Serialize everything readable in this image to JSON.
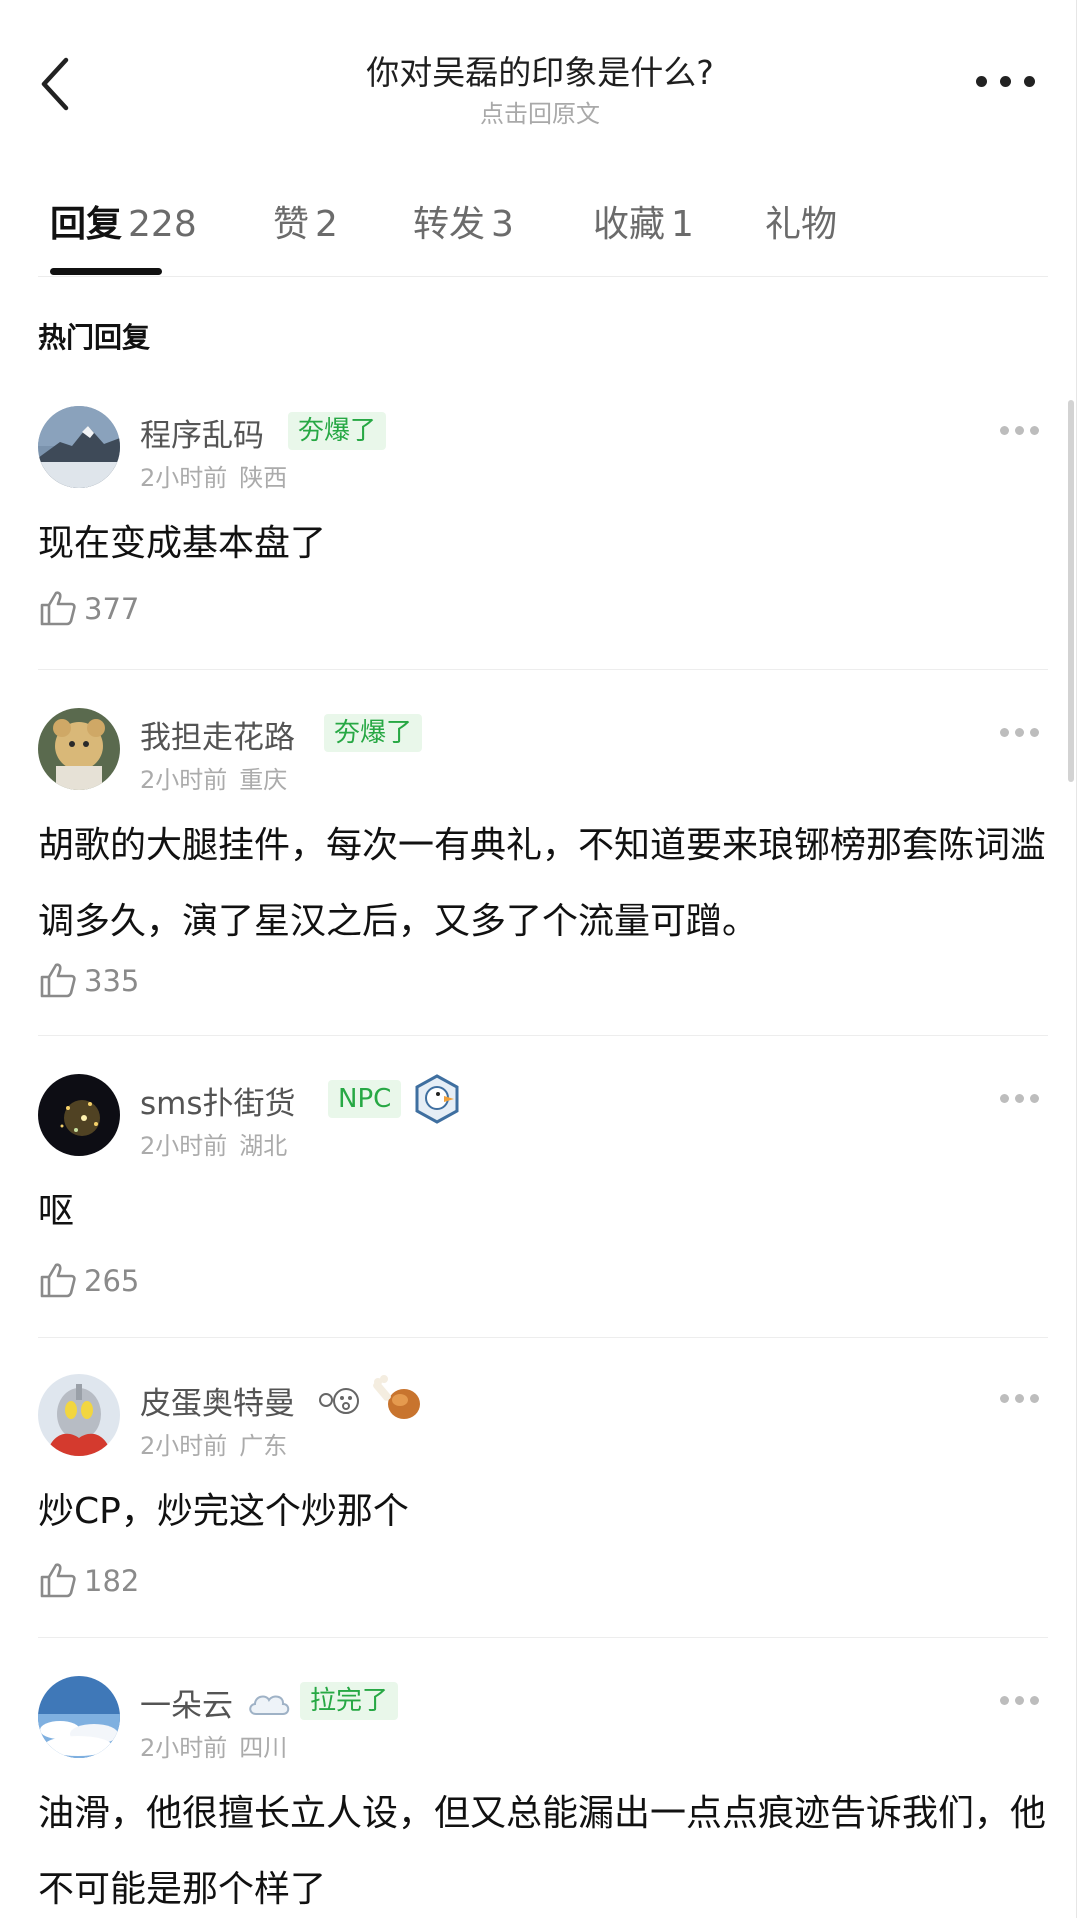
{
  "header": {
    "title": "你对吴磊的印象是什么?",
    "subtitle": "点击回原文",
    "back_icon": "chevron-left-icon",
    "more_icon": "more-horizontal-icon"
  },
  "tabs": [
    {
      "label": "回复",
      "count": "228",
      "active": true
    },
    {
      "label": "赞",
      "count": "2"
    },
    {
      "label": "转发",
      "count": "3"
    },
    {
      "label": "收藏",
      "count": "1"
    },
    {
      "label": "礼物",
      "count": ""
    }
  ],
  "section_title": "热门回复",
  "comments": [
    {
      "username": "程序乱码",
      "badge": "夯爆了",
      "time": "2小时前",
      "location": "陕西",
      "text": "现在变成基本盘了",
      "likes": "377",
      "avatar": "mountain-photo"
    },
    {
      "username": "我担走花路",
      "badge": "夯爆了",
      "time": "2小时前",
      "location": "重庆",
      "text": "胡歌的大腿挂件，每次一有典礼，不知道要来琅铘榜那套陈词滥调多久，演了星汉之后，又多了个流量可蹭。",
      "likes": "335",
      "avatar": "plush-bear-photo"
    },
    {
      "username": "sms扑街货",
      "badge": "NPC",
      "time": "2小时前",
      "location": "湖北",
      "text": "呕",
      "likes": "265",
      "avatar": "dark-sparkle-photo",
      "extra_icon": "duck-hexagon-icon"
    },
    {
      "username": "皮蛋奥特曼",
      "badge": "",
      "time": "2小时前",
      "location": "广东",
      "text": "炒CP，炒完这个炒那个",
      "likes": "182",
      "avatar": "ultraman-photo",
      "extra_icon": "drumstick-icon"
    },
    {
      "username": "一朵云",
      "badge": "拉完了",
      "time": "2小时前",
      "location": "四川",
      "text": "油滑，他很擅长立人设，但又总能漏出一点点痕迹告诉我们，他不可能是那个样了",
      "likes": "",
      "avatar": "sky-clouds-photo",
      "extra_icon": "cloud-icon"
    }
  ],
  "colors": {
    "badge_green": "#27a844",
    "badge_bg": "#e9f7ea",
    "meta_gray": "#ababab"
  }
}
